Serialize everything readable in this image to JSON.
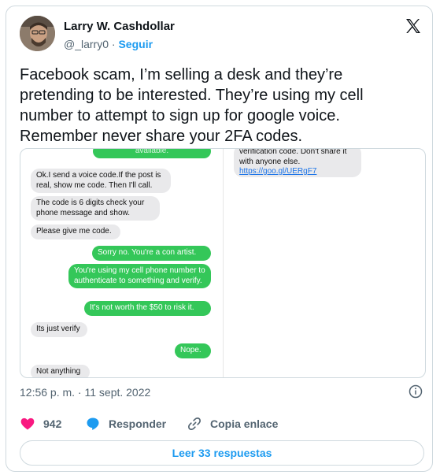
{
  "author": {
    "name": "Larry W. Cashdollar",
    "handle": "@_larry0",
    "separator": "·",
    "follow_label": "Seguir"
  },
  "tweet": {
    "text": "Facebook scam, I’m selling a desk and they’re pretending to be interested. They’re using my cell number to attempt to sign up for google voice. Remember never share your 2FA codes."
  },
  "media": {
    "left_panel": [
      {
        "side": "right",
        "color": "green",
        "text": "available."
      },
      {
        "side": "left",
        "color": "gray",
        "text": "Ok.I send a voice code.If the post is real, show me code. Then I'll call."
      },
      {
        "side": "left",
        "color": "gray",
        "text": "The code is 6 digits check your phone message and show."
      },
      {
        "side": "left",
        "color": "gray",
        "text": "Please give me code."
      },
      {
        "side": "right",
        "color": "green",
        "text": "Sorry no. You're a con artist."
      },
      {
        "side": "right",
        "color": "green",
        "text": "You're using my cell phone number to authenticate to something and verify."
      },
      {
        "side": "right",
        "color": "green",
        "text": "It's not worth the $50 to risk it."
      },
      {
        "side": "left",
        "color": "gray",
        "text": "Its just verify"
      },
      {
        "side": "right",
        "color": "green",
        "text": "Nope."
      },
      {
        "side": "left",
        "color": "gray",
        "text": "Not anything"
      }
    ],
    "right_panel": {
      "text_prefix": "verification code. Don't share it with anyone else. ",
      "link": "https://goo.gl/UERgF7"
    }
  },
  "timestamp": "12:56 p. m. · 11 sept. 2022",
  "actions": {
    "likes_count": "942",
    "reply_label": "Responder",
    "copy_label": "Copia enlace"
  },
  "read_replies_label": "Leer 33 respuestas",
  "colors": {
    "like": "#f91880",
    "accent": "#1d9bf0",
    "imessage_green": "#34c759",
    "imessage_gray": "#e9e9eb"
  }
}
